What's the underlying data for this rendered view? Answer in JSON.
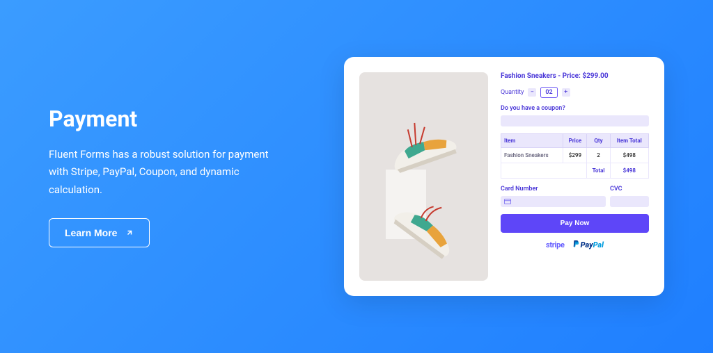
{
  "left": {
    "title": "Payment",
    "description": "Fluent Forms has a robust solution for payment with Stripe, PayPal, Coupon, and dynamic calculation.",
    "cta": "Learn More"
  },
  "form": {
    "product_title": "Fashion Sneakers - Price: $299.00",
    "quantity_label": "Quantity",
    "quantity_value": "02",
    "coupon_label": "Do you have a coupon?",
    "table": {
      "headers": {
        "item": "Item",
        "price": "Price",
        "qty": "Qty",
        "total": "Item Total"
      },
      "row": {
        "item": "Fashion Sneakers",
        "price": "$299",
        "qty": "2",
        "total": "$498"
      },
      "footer": {
        "label": "Total",
        "value": "$498"
      }
    },
    "card_label": "Card Number",
    "cvc_label": "CVC",
    "pay_button": "Pay Now",
    "providers": {
      "stripe": "stripe",
      "paypal_pay": "Pay",
      "paypal_pal": "Pal"
    }
  }
}
